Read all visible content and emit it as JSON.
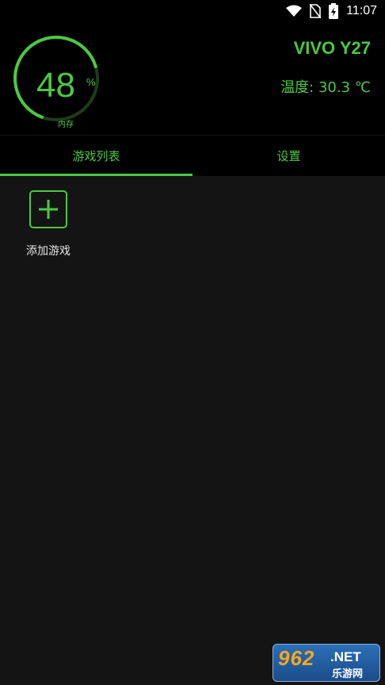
{
  "status_bar": {
    "time": "11:07",
    "icons": [
      "wifi-icon",
      "no-sim-icon",
      "battery-charging-icon"
    ]
  },
  "header": {
    "memory_percent": 48,
    "memory_value": "48",
    "memory_unit": "%",
    "memory_label": "内存",
    "device_name": "VIVO Y27",
    "temperature": "温度: 30.3 ℃"
  },
  "tabs": [
    {
      "label": "游戏列表",
      "active": true
    },
    {
      "label": "设置",
      "active": false
    }
  ],
  "content": {
    "add_game_label": "添加游戏"
  },
  "watermark": {
    "number": "962",
    "net": ".NET",
    "cn": "乐游网"
  },
  "colors": {
    "accent": "#4cc844",
    "background": "#141414",
    "header_bg": "#000000"
  }
}
